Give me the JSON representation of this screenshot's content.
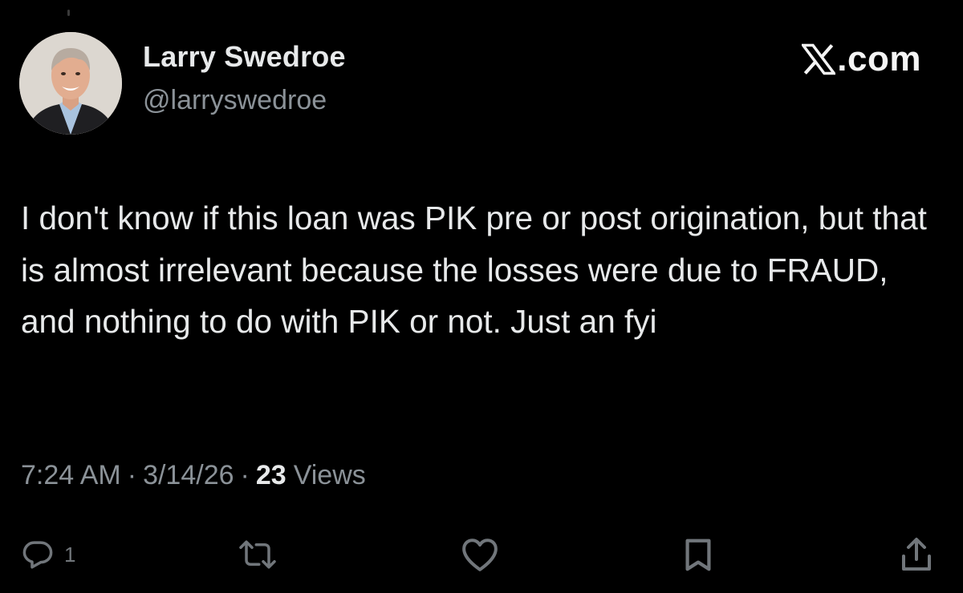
{
  "author": {
    "display_name": "Larry Swedroe",
    "handle": "@larryswedroe",
    "avatar_icon": "profile-photo"
  },
  "brand": {
    "text": ".com",
    "icon": "x-logo-icon"
  },
  "tweet": {
    "text": "I don't know if this loan was PIK pre or post origination, but that is almost irrelevant because the losses were due to FRAUD, and nothing to do with PIK or not. Just an fyi"
  },
  "meta": {
    "time": "7:24 AM",
    "separator": "·",
    "date": "3/14/26",
    "views_count": "23",
    "views_label": "Views"
  },
  "actions": {
    "reply": {
      "icon": "reply-icon",
      "count": "1"
    },
    "retweet": {
      "icon": "retweet-icon"
    },
    "like": {
      "icon": "heart-icon"
    },
    "bookmark": {
      "icon": "bookmark-icon"
    },
    "share": {
      "icon": "share-icon"
    }
  },
  "colors": {
    "background": "#000000",
    "primary_text": "#e7e9ea",
    "secondary_text": "#8b9298",
    "icon": "#71767b"
  }
}
